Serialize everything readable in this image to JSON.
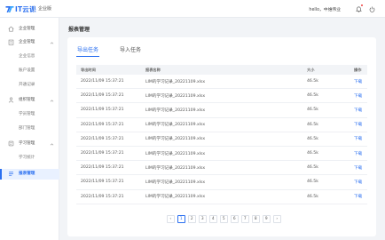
{
  "header": {
    "logo_text": "IT云课",
    "app_title": "企业版",
    "greeting": "hello，中维伟业",
    "icons": [
      "bell-icon",
      "power-icon"
    ],
    "accent_color": "#2a6ff0"
  },
  "sidebar": {
    "items": [
      {
        "label": "企业管理",
        "type": "top",
        "icon": "home-icon"
      },
      {
        "label": "企业管理",
        "type": "group",
        "icon": "building-icon",
        "expanded": true
      },
      {
        "label": "企业信息",
        "type": "sub"
      },
      {
        "label": "账户设置",
        "type": "sub"
      },
      {
        "label": "开通记录",
        "type": "sub"
      },
      {
        "label": "组织管理",
        "type": "group",
        "icon": "org-icon",
        "expanded": true
      },
      {
        "label": "学员管理",
        "type": "sub"
      },
      {
        "label": "部门管理",
        "type": "sub"
      },
      {
        "label": "学习管理",
        "type": "group",
        "icon": "book-icon",
        "expanded": true
      },
      {
        "label": "学习统计",
        "type": "sub"
      },
      {
        "label": "报表管理",
        "type": "top",
        "icon": "report-icon",
        "active": true
      }
    ]
  },
  "main": {
    "page_title": "报表管理",
    "tabs": [
      {
        "label": "导出任务",
        "active": true
      },
      {
        "label": "导入任务",
        "active": false
      }
    ],
    "table": {
      "columns": [
        "导出时间",
        "报表名称",
        "大小",
        "操作"
      ],
      "rows": [
        {
          "time": "2022/11/09  15:37:21",
          "name": "LIM的学习记录_20221109.xlsx",
          "size": "46.5k",
          "action": "下载"
        },
        {
          "time": "2022/11/09  15:37:21",
          "name": "LIM的学习记录_20221109.xlsx",
          "size": "46.5k",
          "action": "下载"
        },
        {
          "time": "2022/11/09  15:37:21",
          "name": "LIM的学习记录_20221109.xlsx",
          "size": "46.5k",
          "action": "下载"
        },
        {
          "time": "2022/11/09  15:37:21",
          "name": "LIM的学习记录_20221109.xlsx",
          "size": "46.5k",
          "action": "下载"
        },
        {
          "time": "2022/11/09  15:37:21",
          "name": "LIM的学习记录_20221109.xlsx",
          "size": "46.5k",
          "action": "下载"
        },
        {
          "time": "2022/11/09  15:37:21",
          "name": "LIM的学习记录_20221109.xlsx",
          "size": "46.5k",
          "action": "下载"
        },
        {
          "time": "2022/11/09  15:37:21",
          "name": "LIM的学习记录_20221109.xlsx",
          "size": "46.5k",
          "action": "下载"
        },
        {
          "time": "2022/11/09  15:37:21",
          "name": "LIM的学习记录_20221109.xlsx",
          "size": "46.5k",
          "action": "下载"
        },
        {
          "time": "2022/11/09  15:37:21",
          "name": "LIM的学习记录_20221109.xlsx",
          "size": "46.5k",
          "action": "下载"
        }
      ]
    },
    "pagination": {
      "prev": "‹",
      "next": "›",
      "pages": [
        "1",
        "2",
        "3",
        "4",
        "5",
        "6",
        "7",
        "8",
        "9"
      ],
      "current": "1"
    }
  }
}
